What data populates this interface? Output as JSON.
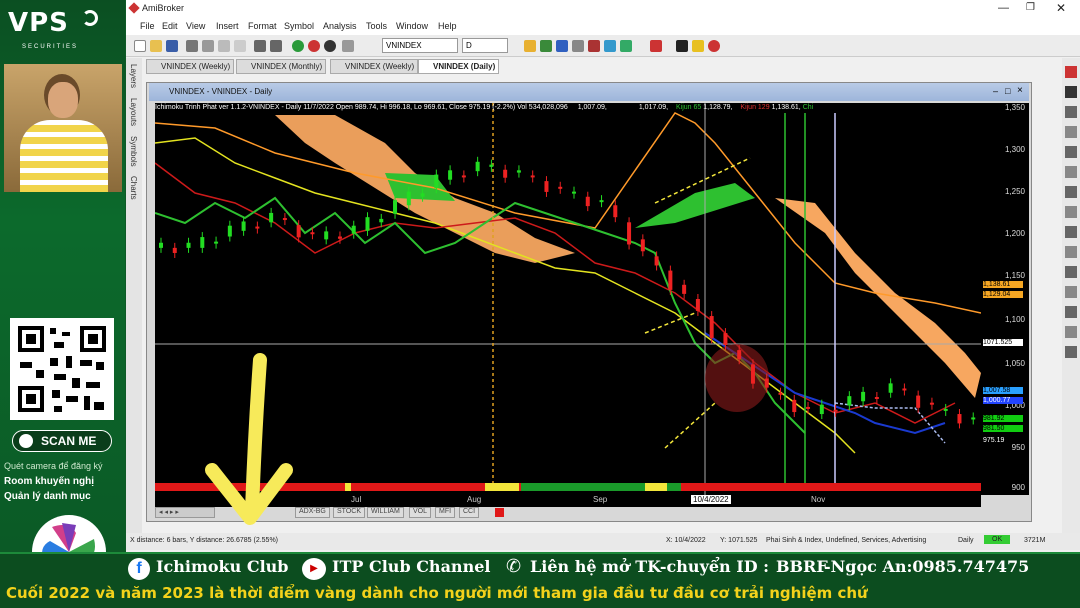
{
  "left_panel": {
    "logo": "VPS",
    "logo_sub": "SECURITIES",
    "scan_me": "SCAN ME",
    "caption": "Quét camera để đăng ký",
    "promo1": "Room khuyến nghị",
    "promo2": "Quản lý danh mục"
  },
  "app": {
    "title": "AmiBroker",
    "menu": [
      "File",
      "Edit",
      "View",
      "Insert",
      "Format",
      "Symbol",
      "Analysis",
      "Tools",
      "Window",
      "Help"
    ],
    "symbol_box": "VNINDEX",
    "interval_box": "D",
    "tabs": [
      {
        "label": "VNINDEX (Weekly)"
      },
      {
        "label": "VNINDEX (Monthly)"
      },
      {
        "label": "VNINDEX (Weekly)"
      },
      {
        "label": "VNINDEX (Daily)"
      }
    ],
    "side_tabs": [
      "Layers",
      "Layouts",
      "Symbols",
      "Charts"
    ]
  },
  "chart_window": {
    "title": "VNINDEX - VNINDEX - Daily",
    "info": "Ichimoku Trinh Phat ver 1.1.2-VNINDEX - Daily 11/7/2022 Open 989.74, Hi 996.18, Lo 969.61, Close 975.19 (-2.2%) Vol 534,028,096",
    "info2": "1,007.09,",
    "info3": "1,017.09,",
    "kijun65": "Kijun 65",
    "info4": "1,128.79,",
    "kijun129": "Kijun 129",
    "info5": "1,138.61,",
    "chikou": "Chi"
  },
  "chart_data": {
    "type": "candlestick",
    "y_ticks": [
      "1,350",
      "1,300",
      "1,250",
      "1,200",
      "1,150",
      "1,100",
      "1,050",
      "1,000",
      "950",
      "900"
    ],
    "x_labels": [
      "Jul",
      "Aug",
      "Sep",
      "Nov"
    ],
    "cursor_date": "10/4/2022",
    "price_tags": [
      {
        "label": "1,138.61",
        "color": "#f5a623"
      },
      {
        "label": "1,129.04",
        "color": "#f5a623"
      },
      {
        "label": "1071.525",
        "color": "#ffffff"
      },
      {
        "label": "1,007.58",
        "color": "#2aa0ff"
      },
      {
        "label": "1,000.77",
        "color": "#2244ff"
      },
      {
        "label": "981.92",
        "color": "#11cc11"
      },
      {
        "label": "981.50",
        "color": "#11cc11"
      },
      {
        "label": "975.19",
        "color": "#ffffff"
      }
    ],
    "approx_close": [
      1180,
      1200,
      1215,
      1190,
      1200,
      1230,
      1260,
      1275,
      1265,
      1245,
      1230,
      1170,
      1120,
      1060,
      1010,
      985,
      1000,
      1015,
      990,
      975
    ]
  },
  "indicator_tabs": [
    "ADX-BG",
    "STOCK",
    "WILLIAM",
    "VOL",
    "MFI",
    "CCI"
  ],
  "statusbar": {
    "distance": "X distance: 6 bars, Y distance: 26.6785 (2.55%)",
    "coords": "X: 10/4/2022",
    "y_coord": "Y: 1071.525",
    "category": "Phai Sinh & Index, Undefined, Services, Advertising",
    "interval": "Daily",
    "ok": "OK",
    "mem": "3721M"
  },
  "bottom": {
    "fb": "Ichimoku Club",
    "yt": "ITP Club Channel",
    "contact": "Liên hệ mở TK-chuyển ID :",
    "id": "BBRF",
    "phone": "-Ngọc An:0985.747475",
    "ticker": "Cuối 2022 và năm 2023 là thời điểm vàng dành cho người mới tham gia đầu tư đầu cơ trải nghiệm chứ"
  }
}
